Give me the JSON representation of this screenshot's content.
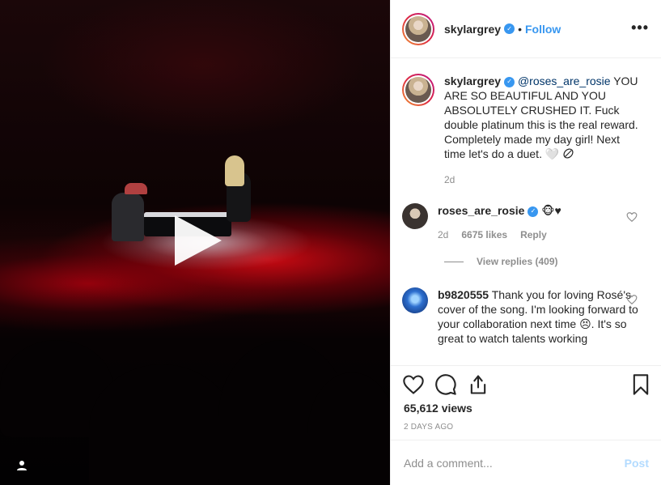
{
  "post": {
    "username": "skylargrey",
    "verified_mark": "✓",
    "separator": "•",
    "follow_label": "Follow",
    "more_label": "•••"
  },
  "caption": {
    "username": "skylargrey",
    "mention": "@roses_are_rosie",
    "text": " YOU ARE SO BEAUTIFUL AND YOU ABSOLUTELY CRUSHED IT. Fuck double platinum this is the real reward. Completely made my day girl! Next time let's do a duet. 🤍",
    "emoji_icon": "leaf-emoji-icon",
    "time": "2d"
  },
  "comments": [
    {
      "username": "roses_are_rosie",
      "text": " 🐵♥",
      "time": "2d",
      "likes": "6675 likes",
      "reply_label": "Reply",
      "view_replies": "View replies (409)"
    },
    {
      "username": "b9820555",
      "text": " Thank you for loving Rosé's cover of the song. I'm looking forward to your collaboration next time 😣. It's so great to watch talents working"
    }
  ],
  "stats": {
    "views": "65,612 views",
    "posted": "2 DAYS AGO"
  },
  "add_comment": {
    "placeholder": "Add a comment...",
    "post_label": "Post"
  },
  "icons": [
    "play-icon",
    "user-tag-icon",
    "heart-icon",
    "comment-icon",
    "share-icon",
    "bookmark-icon",
    "more-options-icon"
  ],
  "colors": {
    "accent": "#3897f0",
    "post_disabled": "#b3dbff",
    "muted": "#8e8e8e"
  }
}
